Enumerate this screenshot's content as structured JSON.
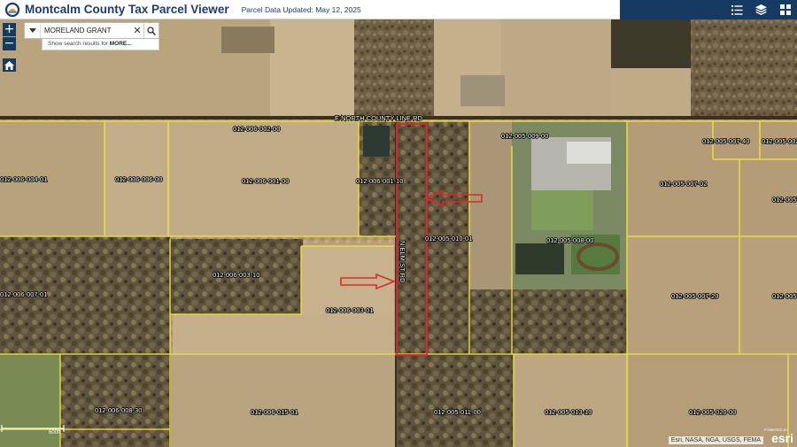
{
  "header": {
    "title": "Montcalm County Tax Parcel Viewer",
    "subtitle": "Parcel Data Updated: May 12, 2025",
    "tools": [
      {
        "name": "list-icon"
      },
      {
        "name": "layers-icon"
      },
      {
        "name": "grid-icon"
      }
    ]
  },
  "controls": {
    "zoom_in": "+",
    "zoom_out": "−",
    "home": "home-icon"
  },
  "search": {
    "value": "MORELAND GRANT",
    "clear": "✕",
    "hint_prefix": "Show search results for",
    "hint_bold": "MORE..."
  },
  "map": {
    "road_north": "E NORTH COUNTY LINE RD",
    "road_vertical": "N ELM ST RD",
    "parcels": [
      "012-006-002-00",
      "012-005-009-00",
      "012-005-007-40",
      "012-005-002",
      "012-006-004-01",
      "012-006-006-00",
      "012-006-001-00",
      "012-006-001-10",
      "012-005-007-02",
      "012-005-0",
      "012-005-010-01",
      "012-005-008-00",
      "012-006-003-10",
      "012-006-007-01",
      "012-006-003-01",
      "012-005-007-20",
      "012-005",
      "012-006-008-30",
      "012-006-015-01",
      "012-005-011-00",
      "012-005-013-10",
      "012-005-020-00"
    ],
    "scale_label": "600ft",
    "attribution": "Esri, NASA, NGA, USGS, FEMA",
    "esri_powered": "POWERED BY",
    "esri_logo": "esri"
  },
  "colors": {
    "header_bg": "#ffffff",
    "title": "#1e3a6e",
    "tools_bg": "#173a63",
    "parcel_line": "#f2e63a",
    "highlight": "#e0262a"
  }
}
